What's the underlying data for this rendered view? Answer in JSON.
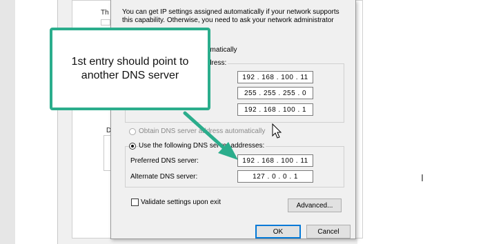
{
  "background": {
    "fragment_top": "Th",
    "fragment_mid": "D"
  },
  "dialog": {
    "intro_line1": "You can get IP settings assigned automatically if your network supports",
    "intro_line2": "this capability. Otherwise, you need to ask your network administrator",
    "frag_automatically": "omatically",
    "frag_addresses": "dress:",
    "ip_address": "192 . 168 . 100 . 11",
    "subnet_mask": "255 . 255 . 255 . 0",
    "default_gateway": "192 . 168 . 100 . 1",
    "obtain_dns_label": "Obtain DNS server address automatically",
    "use_dns_label": "Use the following DNS server addresses:",
    "preferred_dns_label": "Preferred DNS server:",
    "preferred_dns_value": "192 . 168 . 100 . 11",
    "alternate_dns_label": "Alternate DNS server:",
    "alternate_dns_value": "127 . 0 . 0 . 1",
    "validate_label": "Validate settings upon exit",
    "advanced_button": "Advanced...",
    "ok_button": "OK",
    "cancel_button": "Cancel"
  },
  "callout": {
    "text": "1st entry should point to another DNS server",
    "color": "#2bad8c"
  },
  "icons": {
    "cursor": "mouse-pointer-icon",
    "arrow": "callout-arrow"
  }
}
